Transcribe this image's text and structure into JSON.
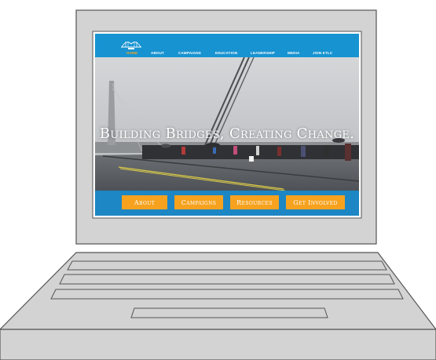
{
  "nav": {
    "items": [
      {
        "label": "HOME",
        "active": true
      },
      {
        "label": "ABOUT",
        "active": false
      },
      {
        "label": "CAMPAIGNS",
        "active": false
      },
      {
        "label": "EDUCATION",
        "active": false
      },
      {
        "label": "LEADERSHIP",
        "active": false
      },
      {
        "label": "MEDIA",
        "active": false
      },
      {
        "label": "JOIN ETLC",
        "active": false
      }
    ]
  },
  "hero": {
    "tagline": "Building Bridges, Creating Change."
  },
  "cta": {
    "about": "About",
    "campaigns": "Campaigns",
    "resources": "Resources",
    "get_involved": "Get Involved"
  },
  "icons": {
    "logo": "bridge-logo-icon"
  },
  "colors": {
    "nav_bg": "#1793d1",
    "accent": "#f6a21f",
    "band_bg": "#1d86c4",
    "laptop_body": "#d3d3d3",
    "laptop_outline": "#555555"
  }
}
